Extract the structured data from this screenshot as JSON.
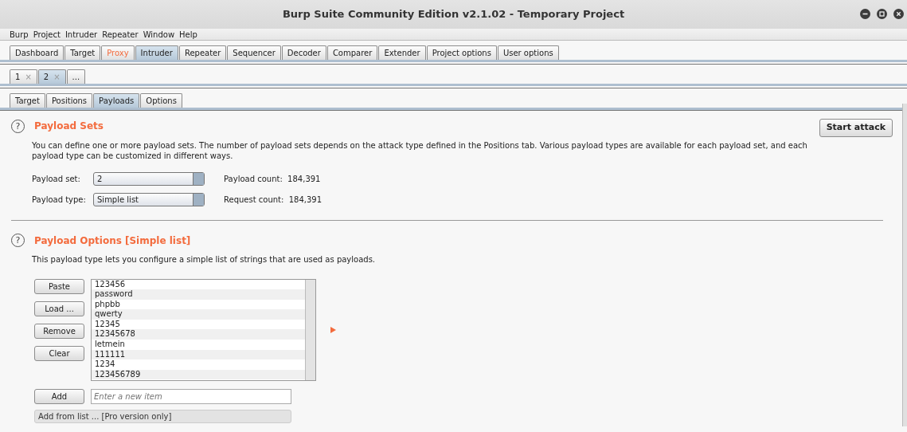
{
  "window": {
    "title": "Burp Suite Community Edition v2.1.02 - Temporary Project"
  },
  "menu": [
    "Burp",
    "Project",
    "Intruder",
    "Repeater",
    "Window",
    "Help"
  ],
  "main_tabs": [
    {
      "label": "Dashboard",
      "selected": false,
      "highlighted": false
    },
    {
      "label": "Target",
      "selected": false,
      "highlighted": false
    },
    {
      "label": "Proxy",
      "selected": false,
      "highlighted": true
    },
    {
      "label": "Intruder",
      "selected": true,
      "highlighted": false
    },
    {
      "label": "Repeater",
      "selected": false,
      "highlighted": false
    },
    {
      "label": "Sequencer",
      "selected": false,
      "highlighted": false
    },
    {
      "label": "Decoder",
      "selected": false,
      "highlighted": false
    },
    {
      "label": "Comparer",
      "selected": false,
      "highlighted": false
    },
    {
      "label": "Extender",
      "selected": false,
      "highlighted": false
    },
    {
      "label": "Project options",
      "selected": false,
      "highlighted": false
    },
    {
      "label": "User options",
      "selected": false,
      "highlighted": false
    }
  ],
  "attack_tabs": [
    {
      "label": "1",
      "close": "×",
      "selected": false
    },
    {
      "label": "2",
      "close": "×",
      "selected": true
    },
    {
      "label": "...",
      "selected": false
    }
  ],
  "sub_tabs": [
    {
      "label": "Target",
      "selected": false
    },
    {
      "label": "Positions",
      "selected": false
    },
    {
      "label": "Payloads",
      "selected": true
    },
    {
      "label": "Options",
      "selected": false
    }
  ],
  "payload_sets": {
    "help": "?",
    "title": "Payload Sets",
    "description": "You can define one or more payload sets. The number of payload sets depends on the attack type defined in the Positions tab. Various payload types are available for each payload set, and each payload type can be customized in different ways.",
    "start_button": "Start attack",
    "fields": [
      {
        "label": "Payload set:",
        "value": "2",
        "info": "Payload count:  184,391"
      },
      {
        "label": "Payload type:",
        "value": "Simple list",
        "info": "Request count:  184,391"
      }
    ]
  },
  "payload_options": {
    "help": "?",
    "title": "Payload Options [Simple list]",
    "description": "This payload type lets you configure a simple list of strings that are used as payloads.",
    "buttons": [
      "Paste",
      "Load ...",
      "Remove",
      "Clear"
    ],
    "items": [
      "123456",
      "password",
      "phpbb",
      "qwerty",
      "12345",
      "12345678",
      "letmein",
      "111111",
      "1234",
      "123456789"
    ],
    "add_button": "Add",
    "add_placeholder": "Enter a new item",
    "add_from_list": {
      "value": "Add from list ... [Pro version only]",
      "disabled": true
    }
  }
}
